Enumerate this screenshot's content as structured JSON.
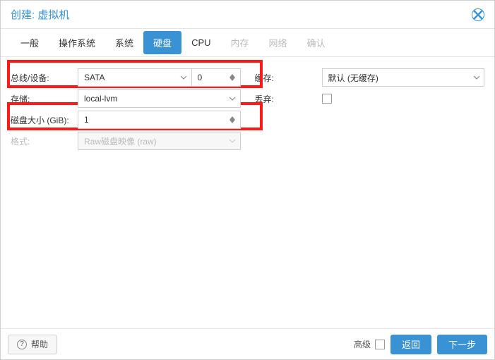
{
  "title": "创建: 虚拟机",
  "tabs": {
    "general": "一般",
    "os": "操作系统",
    "system": "系统",
    "disk": "硬盘",
    "cpu": "CPU",
    "memory": "内存",
    "network": "网络",
    "confirm": "确认"
  },
  "left": {
    "bus_device_label": "总线/设备:",
    "bus_value": "SATA",
    "device_value": "0",
    "storage_label": "存储:",
    "storage_value": "local-lvm",
    "disk_size_label": "磁盘大小 (GiB):",
    "disk_size_value": "1",
    "format_label": "格式:",
    "format_value": "Raw磁盘映像 (raw)"
  },
  "right": {
    "cache_label": "缓存:",
    "cache_value": "默认 (无缓存)",
    "discard_label": "丢弃:"
  },
  "footer": {
    "help": "帮助",
    "advanced": "高级",
    "back": "返回",
    "next": "下一步"
  }
}
